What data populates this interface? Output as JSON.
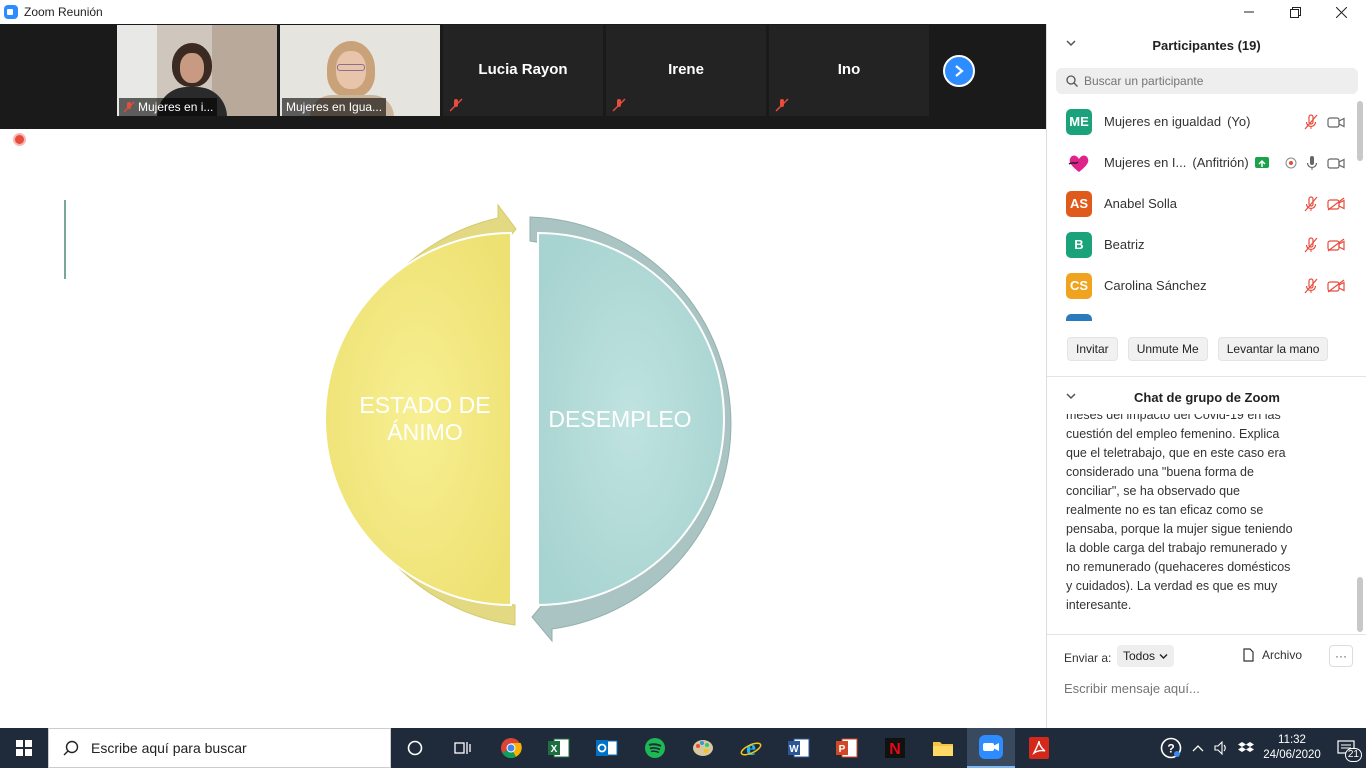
{
  "window": {
    "title": "Zoom Reunión"
  },
  "video_strip": {
    "tiles": [
      {
        "name": "Mujeres en i...",
        "type": "video",
        "muted": true
      },
      {
        "name": "Mujeres en Igua...",
        "type": "video",
        "muted": false,
        "active": true
      },
      {
        "name": "Lucia Rayon",
        "type": "name",
        "muted": true
      },
      {
        "name": "Irene",
        "type": "name",
        "muted": true
      },
      {
        "name": "Ino",
        "type": "name",
        "muted": true
      }
    ]
  },
  "slide": {
    "left_label_line1": "ESTADO DE",
    "left_label_line2": "ÁNIMO",
    "right_label": "DESEMPLEO",
    "colors": {
      "left": "#f0e67a",
      "left_ring": "#e2d982",
      "right": "#b0d9d6",
      "right_ring": "#9fbdbc"
    }
  },
  "participants": {
    "header": "Participantes (19)",
    "search_placeholder": "Buscar un participante",
    "items": [
      {
        "initials": "ME",
        "name": "Mujeres en igualdad",
        "role": "(Yo)",
        "color": "#1aa37a",
        "mic": "off",
        "video": "on"
      },
      {
        "initials": "",
        "name": "Mujeres en I...",
        "role": "(Anfitrión)",
        "color": "#ffffff",
        "mic": "on",
        "video": "on",
        "logo": true
      },
      {
        "initials": "AS",
        "name": "Anabel Solla",
        "role": "",
        "color": "#e05a1c",
        "mic": "off",
        "video": "off"
      },
      {
        "initials": "B",
        "name": "Beatriz",
        "role": "",
        "color": "#1aa37a",
        "mic": "off",
        "video": "off"
      },
      {
        "initials": "CS",
        "name": "Carolina Sánchez",
        "role": "",
        "color": "#f0a31e",
        "mic": "off",
        "video": "off"
      }
    ],
    "buttons": {
      "invite": "Invitar",
      "unmute": "Unmute Me",
      "raise_hand": "Levantar la mano"
    }
  },
  "chat": {
    "header": "Chat de grupo de Zoom",
    "lines": [
      "meses del impacto del Covid-19 en las",
      "cuestión del empleo femenino. Explica",
      "que el teletrabajo, que en este caso era",
      "considerado una \"buena forma de",
      "conciliar\", se ha observado que",
      "realmente no es tan eficaz como se",
      "pensaba, porque la mujer sigue teniendo",
      "la doble carga del trabajo remunerado y",
      "no remunerado (quehaceres domésticos",
      "y cuidados). La verdad es que es muy",
      "interesante."
    ],
    "send_to_label": "Enviar a:",
    "send_to_value": "Todos",
    "file_label": "Archivo",
    "more_label": "···",
    "input_placeholder": "Escribir mensaje aquí..."
  },
  "taskbar": {
    "search_placeholder": "Escribe aquí para buscar",
    "time": "11:32",
    "date": "24/06/2020",
    "notification_count": "21"
  }
}
